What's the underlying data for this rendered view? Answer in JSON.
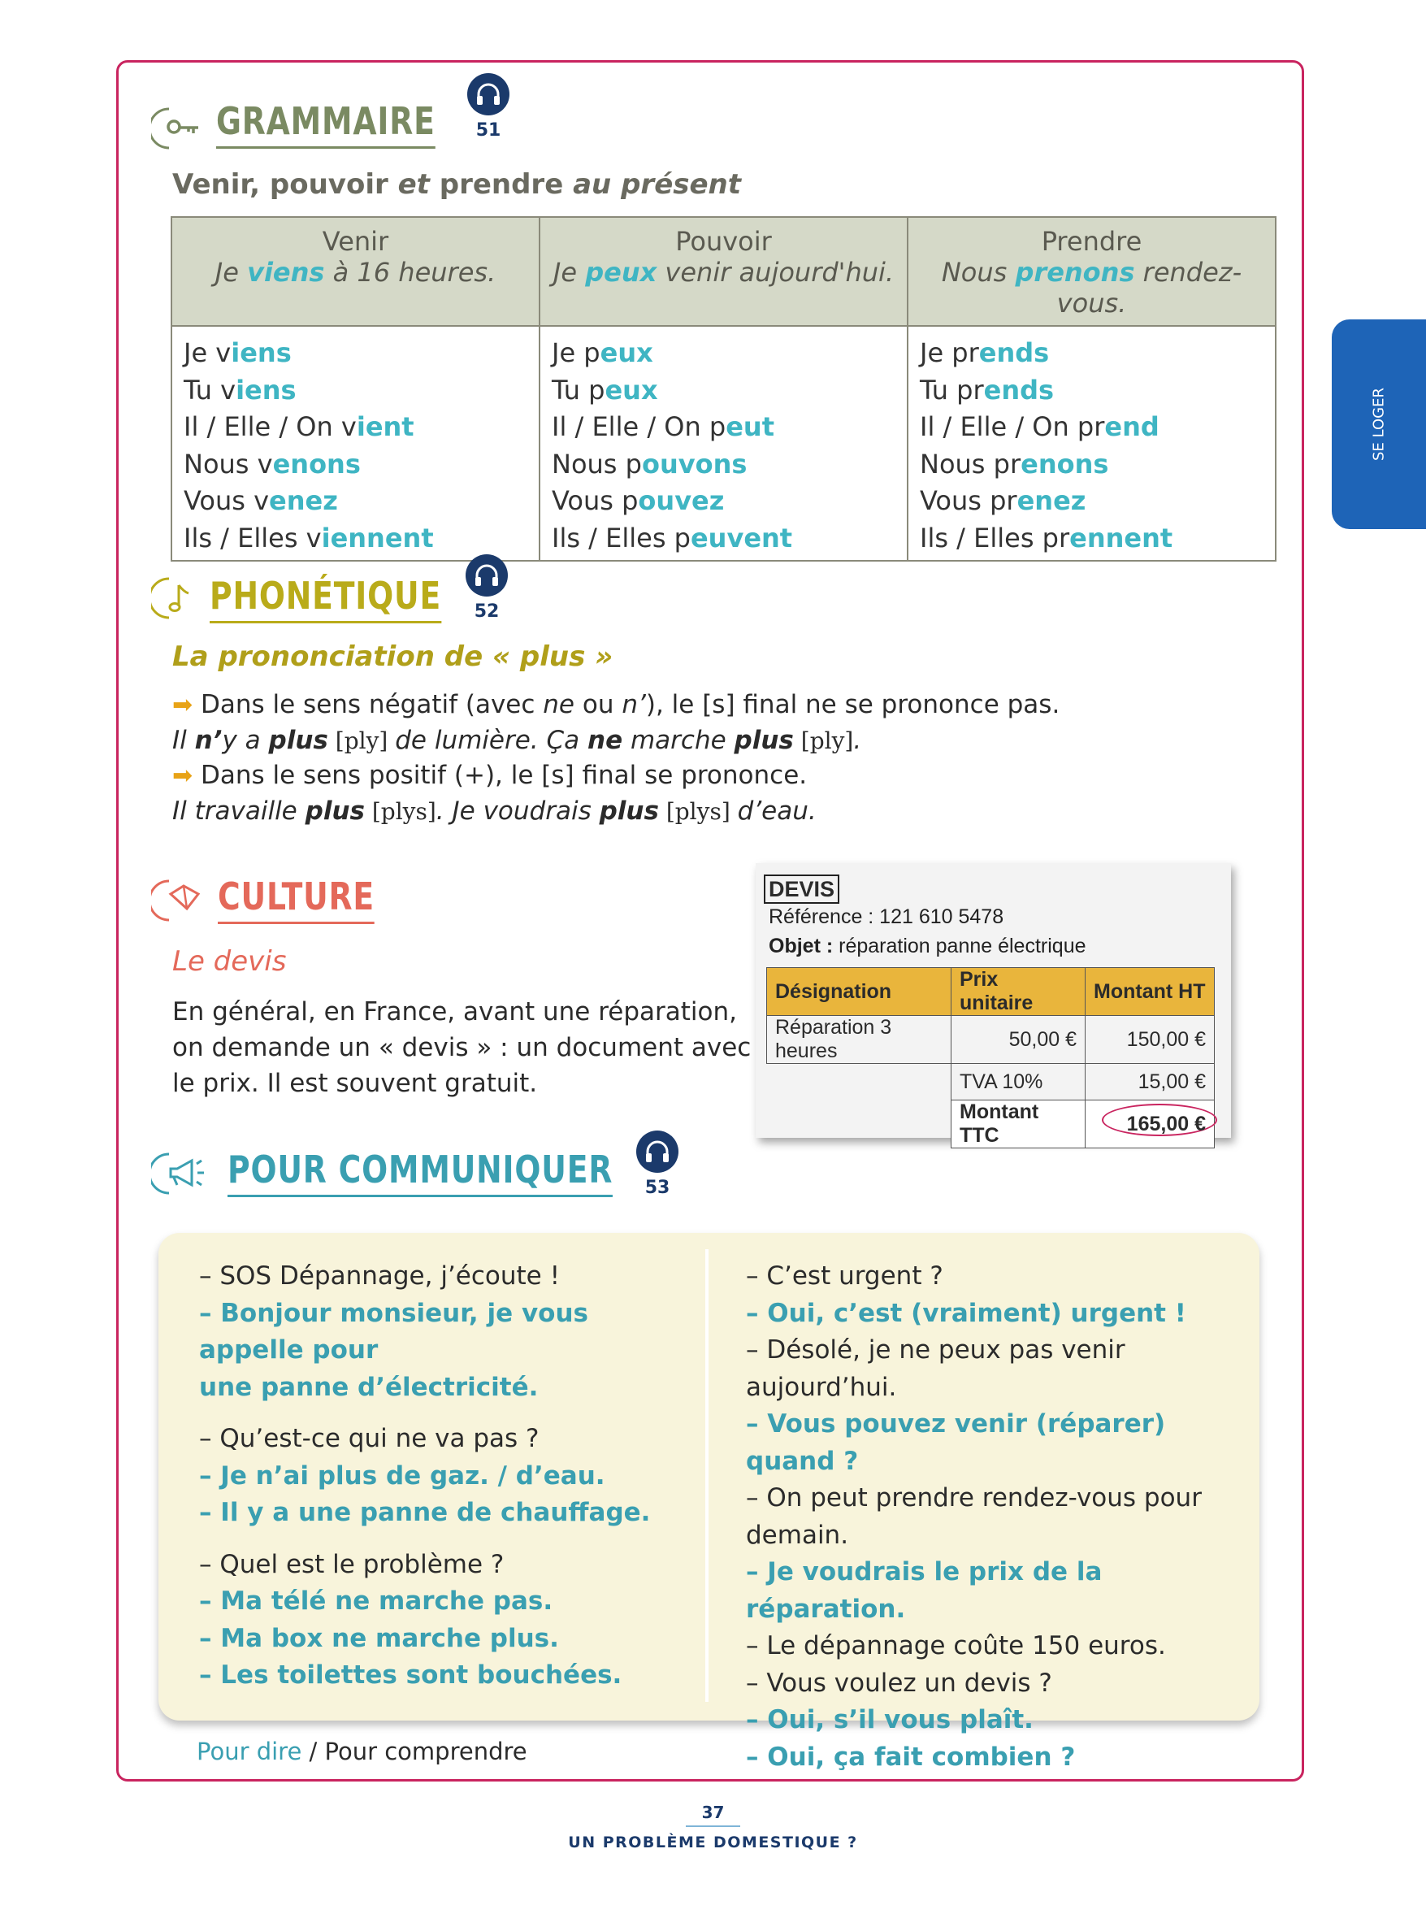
{
  "side_tab": "SE LOGER",
  "grammaire": {
    "title": "GRAMMAIRE",
    "audio": "51",
    "subtitle_a": "Venir, pouvoir ",
    "subtitle_b": "et",
    "subtitle_c": " prendre ",
    "subtitle_d": "au présent",
    "columns": [
      {
        "verb": "Venir",
        "example": [
          {
            "t": "Je "
          },
          {
            "t": "viens",
            "h": true
          },
          {
            "t": " à 16 heures."
          }
        ],
        "rows": [
          [
            {
              "t": "Je v"
            },
            {
              "t": "iens",
              "h": true
            }
          ],
          [
            {
              "t": "Tu v"
            },
            {
              "t": "iens",
              "h": true
            }
          ],
          [
            {
              "t": "Il / Elle / On v"
            },
            {
              "t": "ient",
              "h": true
            }
          ],
          [
            {
              "t": "Nous v"
            },
            {
              "t": "enons",
              "h": true
            }
          ],
          [
            {
              "t": "Vous v"
            },
            {
              "t": "enez",
              "h": true
            }
          ],
          [
            {
              "t": "Ils / Elles v"
            },
            {
              "t": "iennent",
              "h": true
            }
          ]
        ]
      },
      {
        "verb": "Pouvoir",
        "example": [
          {
            "t": "Je "
          },
          {
            "t": "peux",
            "h": true
          },
          {
            "t": " venir aujourd'hui."
          }
        ],
        "rows": [
          [
            {
              "t": "Je p"
            },
            {
              "t": "eux",
              "h": true
            }
          ],
          [
            {
              "t": "Tu p"
            },
            {
              "t": "eux",
              "h": true
            }
          ],
          [
            {
              "t": "Il / Elle / On p"
            },
            {
              "t": "eut",
              "h": true
            }
          ],
          [
            {
              "t": "Nous p"
            },
            {
              "t": "ouvons",
              "h": true
            }
          ],
          [
            {
              "t": "Vous p"
            },
            {
              "t": "ouvez",
              "h": true
            }
          ],
          [
            {
              "t": "Ils / Elles p"
            },
            {
              "t": "euvent",
              "h": true
            }
          ]
        ]
      },
      {
        "verb": "Prendre",
        "example": [
          {
            "t": "Nous "
          },
          {
            "t": "prenons",
            "h": true
          },
          {
            "t": " rendez-vous."
          }
        ],
        "rows": [
          [
            {
              "t": "Je pr"
            },
            {
              "t": "ends",
              "h": true
            }
          ],
          [
            {
              "t": "Tu pr"
            },
            {
              "t": "ends",
              "h": true
            }
          ],
          [
            {
              "t": "Il / Elle / On pr"
            },
            {
              "t": "end",
              "h": true
            }
          ],
          [
            {
              "t": "Nous pr"
            },
            {
              "t": "enons",
              "h": true
            }
          ],
          [
            {
              "t": "Vous pr"
            },
            {
              "t": "enez",
              "h": true
            }
          ],
          [
            {
              "t": "Ils / Elles pr"
            },
            {
              "t": "ennent",
              "h": true
            }
          ]
        ]
      }
    ]
  },
  "phonetique": {
    "title": "PHONÉTIQUE",
    "audio": "52",
    "subtitle": "La prononciation de « plus »",
    "rule1": [
      {
        "t": "Dans le sens négatif (avec "
      },
      {
        "t": "ne",
        "i": true
      },
      {
        "t": " ou "
      },
      {
        "t": "n’",
        "i": true
      },
      {
        "t": "), le [s] final ne se prononce pas."
      }
    ],
    "example1": [
      {
        "t": "Il ",
        "i": true
      },
      {
        "t": "n’",
        "i": true,
        "b": true
      },
      {
        "t": "y a ",
        "i": true
      },
      {
        "t": "plus",
        "i": true,
        "b": true
      },
      {
        "t": " [ply] ",
        "ipa": true
      },
      {
        "t": "de lumière. Ça ",
        "i": true
      },
      {
        "t": "ne",
        "i": true,
        "b": true
      },
      {
        "t": " marche ",
        "i": true
      },
      {
        "t": "plus",
        "i": true,
        "b": true
      },
      {
        "t": " [ply]",
        "ipa": true
      },
      {
        "t": ".",
        "i": true
      }
    ],
    "rule2": [
      {
        "t": "Dans le sens positif (+), le [s] final se prononce."
      }
    ],
    "example2": [
      {
        "t": "Il travaille ",
        "i": true
      },
      {
        "t": "plus",
        "i": true,
        "b": true
      },
      {
        "t": " [plys]",
        "ipa": true
      },
      {
        "t": ". Je voudrais ",
        "i": true
      },
      {
        "t": "plus",
        "i": true,
        "b": true
      },
      {
        "t": " [plys] ",
        "ipa": true
      },
      {
        "t": "d’eau.",
        "i": true
      }
    ]
  },
  "culture": {
    "title": "CULTURE",
    "subtitle": "Le devis",
    "lines": [
      "En général, en France, avant une réparation,",
      "on demande un « devis » : un document avec",
      "le prix. Il est souvent gratuit."
    ]
  },
  "devis": {
    "label": "DEVIS",
    "reference": "Référence : 121 610 5478",
    "objet_label": "Objet :",
    "objet_value": " réparation panne électrique",
    "headers": [
      "Désignation",
      "Prix unitaire",
      "Montant HT"
    ],
    "row1": [
      "Réparation 3 heures",
      "50,00 €",
      "150,00 €"
    ],
    "row2": [
      "",
      "TVA 10%",
      "15,00 €"
    ],
    "row3": [
      "",
      "Montant TTC",
      "165,00 €"
    ]
  },
  "communiquer": {
    "title": "POUR COMMUNIQUER",
    "audio": "53",
    "left": [
      {
        "t": "– SOS Dépannage, j’écoute !"
      },
      {
        "t": "– Bonjour monsieur, je vous appelle pour",
        "b": true
      },
      {
        "t": "une panne d’électricité.",
        "b": true
      },
      {
        "gap": true
      },
      {
        "t": "– Qu’est-ce qui ne va pas ?"
      },
      {
        "t": "– Je n’ai plus de gaz. / d’eau.",
        "b": true
      },
      {
        "t": "– Il y a une panne de chauffage.",
        "b": true
      },
      {
        "gap": true
      },
      {
        "t": "– Quel est le problème ?"
      },
      {
        "t": "– Ma télé ne marche pas.",
        "b": true
      },
      {
        "t": "– Ma box ne marche plus.",
        "b": true
      },
      {
        "t": "– Les toilettes sont bouchées.",
        "b": true
      }
    ],
    "right": [
      {
        "t": "– C’est urgent ?"
      },
      {
        "t": "– Oui, c’est (vraiment) urgent !",
        "b": true
      },
      {
        "t": "– Désolé, je ne peux pas venir"
      },
      {
        "t": "aujourd’hui."
      },
      {
        "t": "– Vous pouvez venir (réparer) quand ?",
        "b": true
      },
      {
        "t": "– On peut prendre rendez-vous pour"
      },
      {
        "t": "demain."
      },
      {
        "t": "– Je voudrais le prix de la réparation.",
        "b": true
      },
      {
        "t": "– Le dépannage coûte 150 euros."
      },
      {
        "t": "– Vous voulez un devis ?"
      },
      {
        "t": "– Oui, s’il vous plaît.",
        "b": true
      },
      {
        "t": "– Oui, ça fait combien ?",
        "b": true
      }
    ],
    "legend_dire": "Pour dire",
    "legend_rest": " / Pour comprendre"
  },
  "footer": {
    "page_number": "37",
    "unit_title": "UN PROBLÈME DOMESTIQUE ?"
  },
  "colors": {
    "frame": "#c9245f",
    "grammaire": "#7a8a62",
    "phonetique": "#b9ab1a",
    "culture": "#e4695a",
    "communiquer": "#3a9fb1",
    "highlight": "#3fb5c3",
    "audio": "#1b3a6b",
    "side_tab": "#1e64b7"
  }
}
